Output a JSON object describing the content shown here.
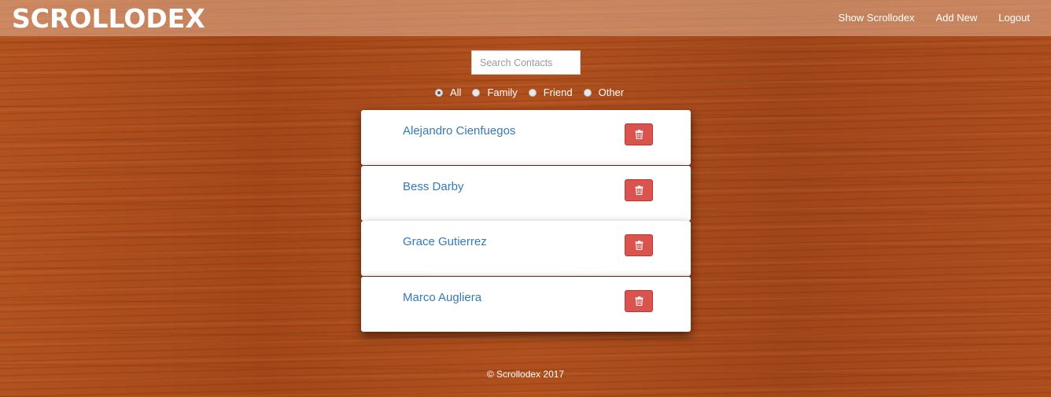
{
  "navbar": {
    "brand": "SCROLLODEX",
    "links": [
      "Show Scrollodex",
      "Add New",
      "Logout"
    ]
  },
  "search": {
    "placeholder": "Search Contacts",
    "value": ""
  },
  "filters": {
    "options": [
      "All",
      "Family",
      "Friend",
      "Other"
    ],
    "selected": "All"
  },
  "contacts": [
    {
      "name": "Alejandro Cienfuegos"
    },
    {
      "name": "Bess Darby"
    },
    {
      "name": "Grace Gutierrez"
    },
    {
      "name": "Marco Augliera"
    }
  ],
  "footer": {
    "text": "© Scrollodex 2017"
  },
  "colors": {
    "link": "#337ab7",
    "delete_button": "#d9534f",
    "background": "#a84a1c"
  },
  "icons": {
    "delete": "trash-icon"
  }
}
